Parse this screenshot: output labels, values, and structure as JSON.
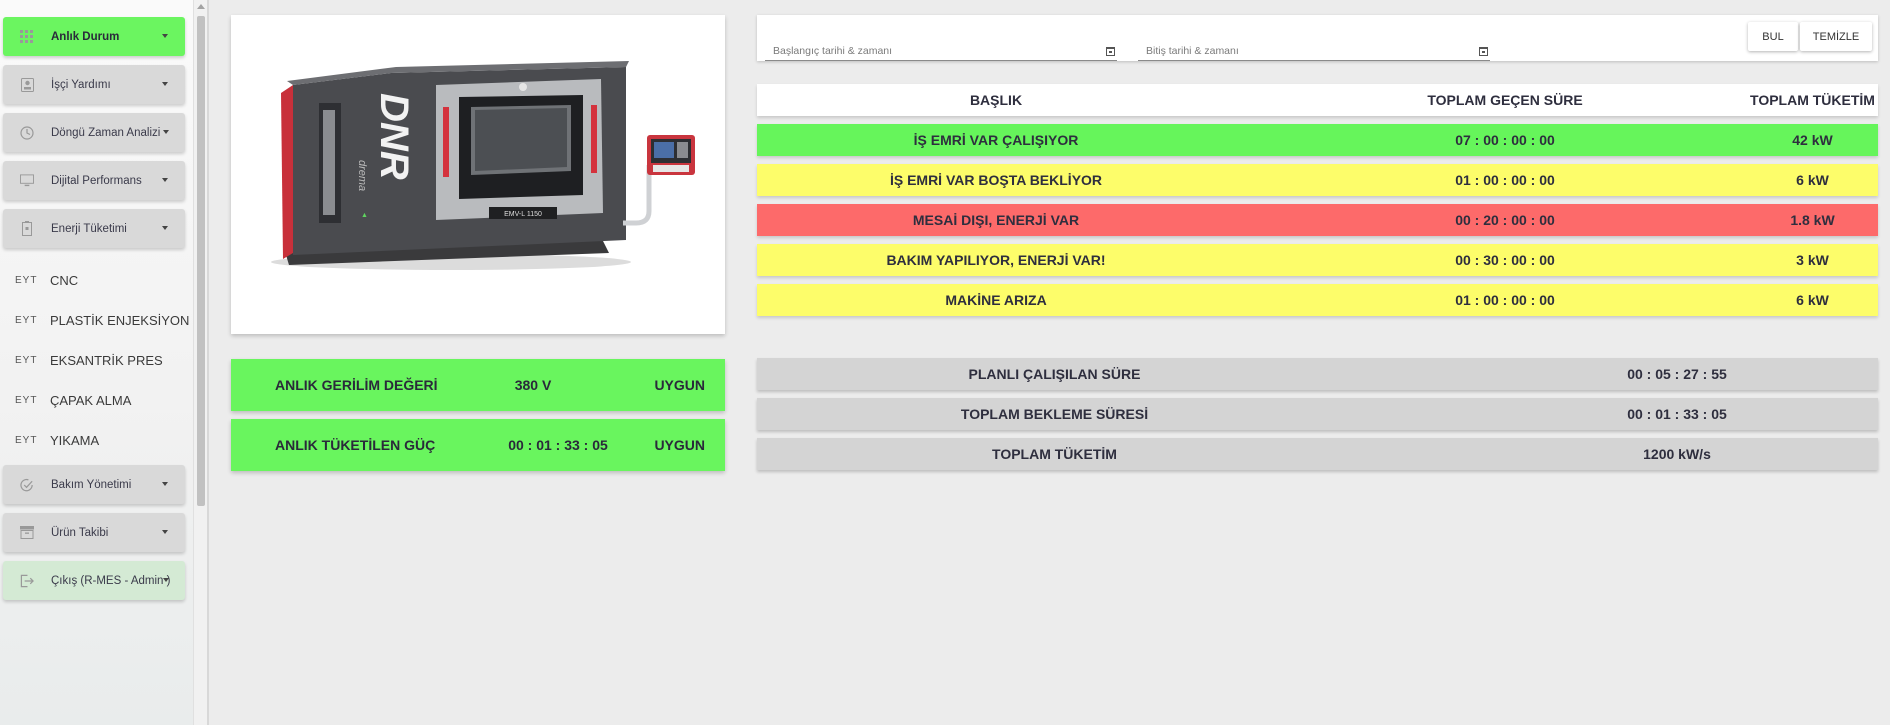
{
  "sidebar": {
    "menu": [
      {
        "label": "Anlık Durum",
        "icon": "grid-icon",
        "active": true
      },
      {
        "label": "İşçi Yardımı",
        "icon": "badge-icon"
      },
      {
        "label": "Döngü Zaman Analizi",
        "icon": "clock-icon"
      },
      {
        "label": "Dijital Performans",
        "icon": "monitor-icon"
      },
      {
        "label": "Enerji Tüketimi",
        "icon": "battery-icon"
      }
    ],
    "sub_items": [
      {
        "code": "EYT",
        "label": "CNC"
      },
      {
        "code": "EYT",
        "label": "PLASTİK ENJEKSİYON"
      },
      {
        "code": "EYT",
        "label": "EKSANTRİK PRES"
      },
      {
        "code": "EYT",
        "label": "ÇAPAK ALMA"
      },
      {
        "code": "EYT",
        "label": "YIKAMA"
      }
    ],
    "menu_bottom": [
      {
        "label": "Bakım Yönetimi",
        "icon": "check-gauge-icon"
      },
      {
        "label": "Ürün Takibi",
        "icon": "archive-icon"
      },
      {
        "label": "Çıkış (R-MES - Admin )",
        "icon": "logout-icon"
      }
    ]
  },
  "machine": {
    "brand": "DNR",
    "sub_brand": "drema",
    "model_plate": "EMV-L 1150"
  },
  "status_boxes": [
    {
      "label": "ANLIK GERİLİM DEĞERİ",
      "value": "380 V",
      "state": "UYGUN"
    },
    {
      "label": "ANLIK TÜKETİLEN GÜÇ",
      "value": "00 : 01 : 33 : 05",
      "state": "UYGUN"
    }
  ],
  "filter": {
    "start_placeholder": "Başlangıç tarihi & zamanı",
    "end_placeholder": "Bitiş tarihi & zamanı",
    "find_label": "BUL",
    "clear_label": "TEMİZLE"
  },
  "table": {
    "headers": [
      "BAŞLIK",
      "TOPLAM GEÇEN SÜRE",
      "TOPLAM TÜKETİM"
    ],
    "rows": [
      {
        "title": "İŞ EMRİ VAR ÇALIŞIYOR",
        "duration": "07 : 00 : 00 : 00",
        "consumption": "42 kW",
        "color": "#66f55b"
      },
      {
        "title": "İŞ EMRİ VAR BOŞTA BEKLİYOR",
        "duration": "01 : 00 : 00 : 00",
        "consumption": "6 kW",
        "color": "#fdfd6a"
      },
      {
        "title": "MESAİ DIŞI, ENERJİ VAR",
        "duration": "00 : 20 : 00 : 00",
        "consumption": "1.8 kW",
        "color": "#fd6a6a"
      },
      {
        "title": "BAKIM YAPILIYOR, ENERJİ VAR!",
        "duration": "00 : 30 : 00 : 00",
        "consumption": "3 kW",
        "color": "#fdfd6a"
      },
      {
        "title": "MAKİNE ARIZA",
        "duration": "01 : 00 : 00 : 00",
        "consumption": "6 kW",
        "color": "#fdfd6a"
      }
    ]
  },
  "summary": [
    {
      "label": "PLANLI ÇALIŞILAN SÜRE",
      "value": "00 : 05 : 27 : 55"
    },
    {
      "label": "TOPLAM BEKLEME SÜRESİ",
      "value": "00 : 01 : 33 : 05"
    },
    {
      "label": "TOPLAM TÜKETİM",
      "value": "1200 kW/s"
    }
  ],
  "colors": {
    "active_green": "#6bf560",
    "status_green": "#69f55e",
    "warn_yellow": "#fdfd6a",
    "alert_red": "#fd6a6a",
    "summary_gray": "#d4d4d4"
  }
}
